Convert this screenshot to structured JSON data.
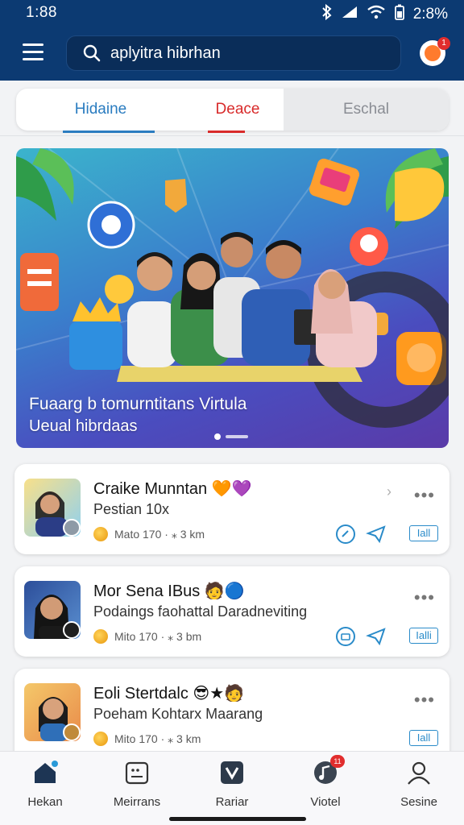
{
  "status": {
    "time": "1:88",
    "battery": "2:8%"
  },
  "header": {
    "search_text": "aplyitra hibrhan",
    "notification_count": "1"
  },
  "tabs": [
    {
      "label": "Hidaine",
      "color": "#2a7cc0"
    },
    {
      "label": "Deace",
      "color": "#d82a2a"
    },
    {
      "label": "Eschal",
      "color": "#8a8d94"
    }
  ],
  "banner": {
    "title": "Fuaarg b tomurntitans Virtula",
    "subtitle": "Ueual hibrdaas"
  },
  "cards": [
    {
      "name": "Craike Munntan",
      "emojis": "🧡💜",
      "sub": "Pestian 10x",
      "meta": "Mato 170 · ⁎ 3 km",
      "tag": "Iall"
    },
    {
      "name": "Mor Sena IBus",
      "emojis": "🧑🔵",
      "sub": "Podaings faohattal Daradneviting",
      "meta": "Mito 170 · ⁎ 3 bm",
      "tag": "Ialli"
    },
    {
      "name": "Eoli Stertdalc",
      "emojis": "😎★🧑",
      "sub": "Poeham Kohtarx Maarang",
      "meta": "Mito 170 · ⁎ 3 km",
      "tag": "Iall"
    }
  ],
  "bottom_nav": [
    {
      "label": "Hekan",
      "icon": "home-icon"
    },
    {
      "label": "Meirrans",
      "icon": "calendar-icon"
    },
    {
      "label": "Rariar",
      "icon": "check-icon"
    },
    {
      "label": "Viotel",
      "icon": "music-icon",
      "badge": "11"
    },
    {
      "label": "Sesine",
      "icon": "profile-icon"
    }
  ],
  "colors": {
    "header": "#0c3a72",
    "accent": "#2a7cc0",
    "danger": "#d82a2a"
  }
}
